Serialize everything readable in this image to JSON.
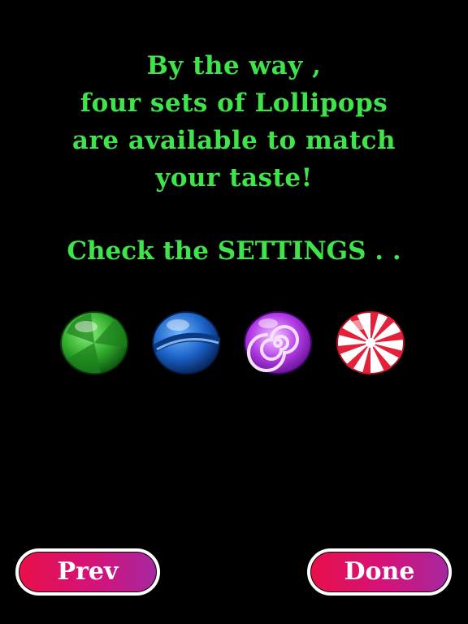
{
  "message": {
    "lines": [
      "By the way ,",
      "four sets of Lollipops",
      "are available to match",
      "your taste!"
    ],
    "settings_line": "Check the SETTINGS . ."
  },
  "candies": [
    {
      "name": "green swirl",
      "colors": [
        "#1e8a1e",
        "#5fd14a"
      ]
    },
    {
      "name": "blue ringed",
      "colors": [
        "#0b3f8f",
        "#3a8fe6"
      ]
    },
    {
      "name": "purple spiral",
      "colors": [
        "#8a1fc4",
        "#e6a8ff"
      ]
    },
    {
      "name": "red peppermint",
      "colors": [
        "#e3213b",
        "#ffffff"
      ]
    }
  ],
  "buttons": {
    "prev_label": "Prev",
    "done_label": "Done"
  },
  "colors": {
    "text": "#3fe34a",
    "background": "#000000",
    "button_start": "#e8104a",
    "button_end": "#a528a0"
  }
}
